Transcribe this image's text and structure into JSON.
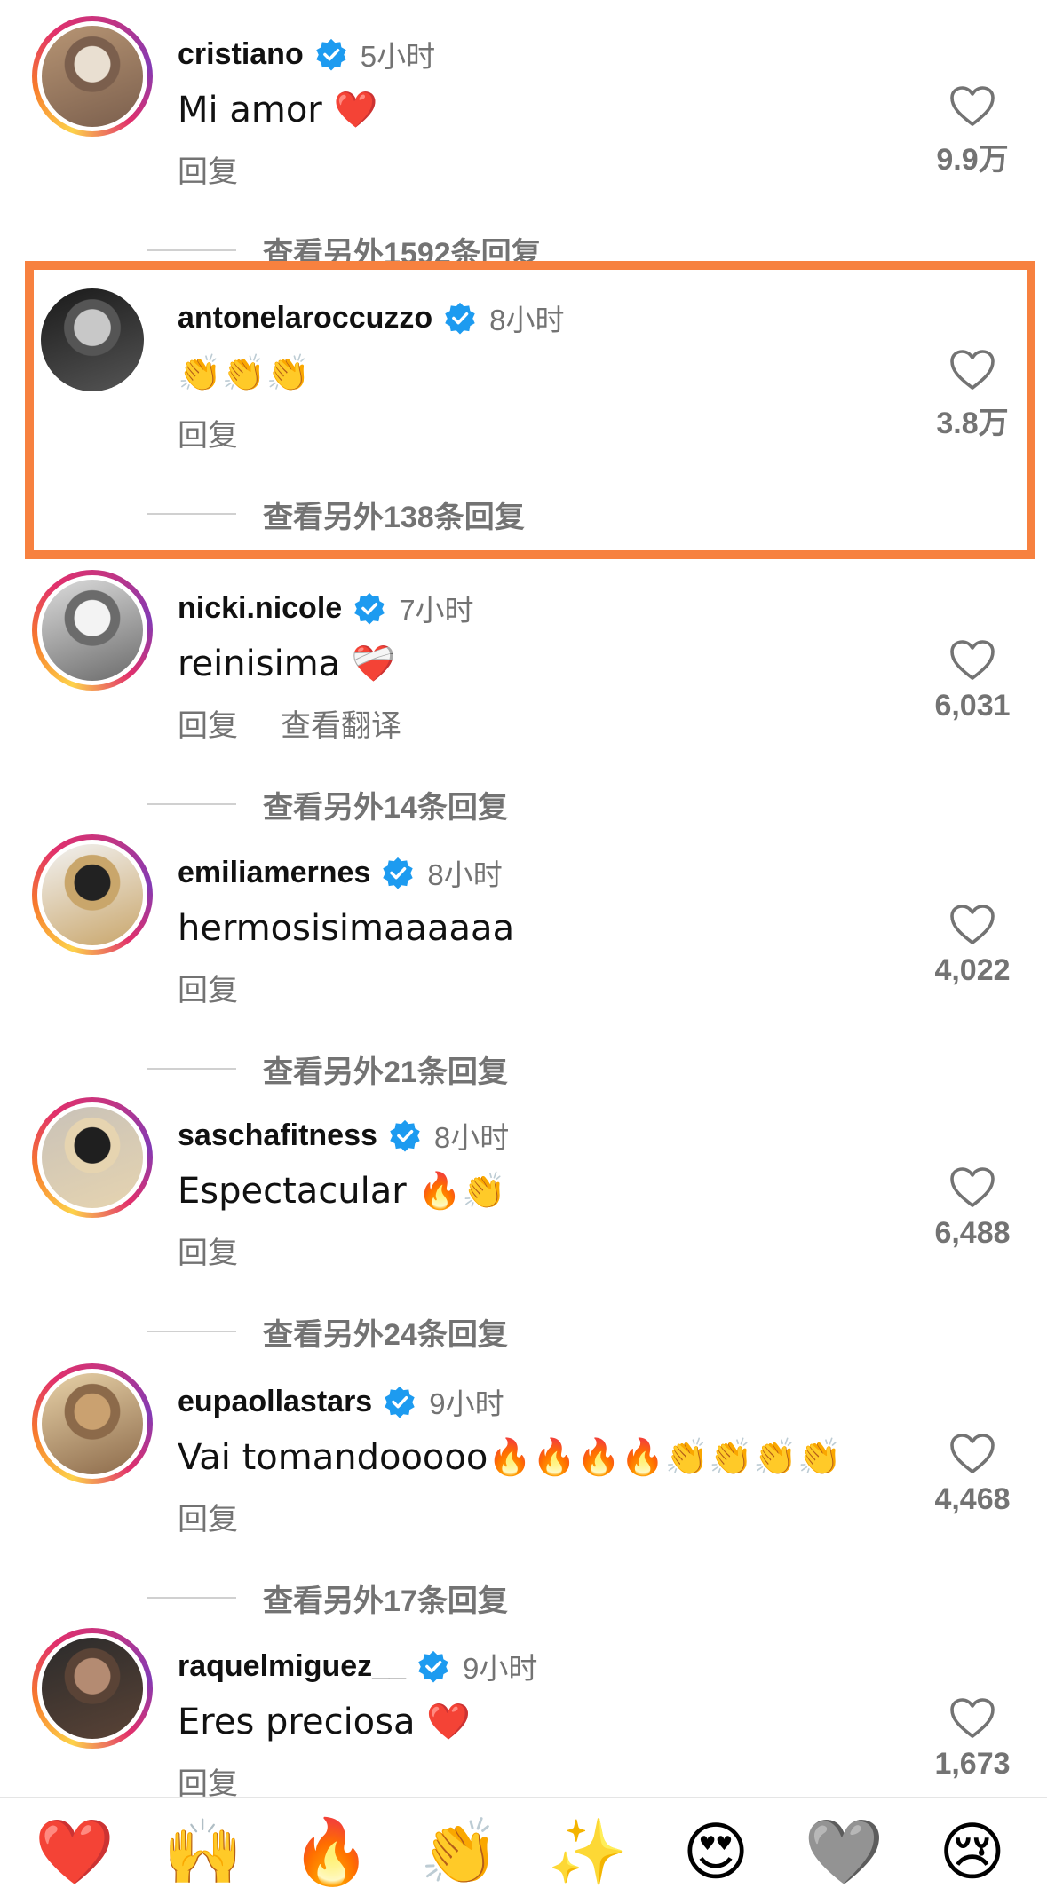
{
  "comments": [
    {
      "username": "cristiano",
      "time": "5小时",
      "text": "Mi amor ❤️",
      "reply": "回复",
      "likes": "9.9万",
      "view_replies": "查看另外1592条回复",
      "ring": true,
      "avatar_colors": [
        "#b79574",
        "#e9dfd1",
        "#7b5f4d"
      ]
    },
    {
      "username": "antonelaroccuzzo",
      "time": "8小时",
      "text": "👏👏👏",
      "reply": "回复",
      "likes": "3.8万",
      "view_replies": "查看另外138条回复",
      "ring": false,
      "avatar_colors": [
        "#1a1a1a",
        "#c8c8c8",
        "#555555"
      ]
    },
    {
      "username": "nicki.nicole",
      "time": "7小时",
      "text": "reinisima ❤️‍🩹",
      "reply": "回复",
      "translate": "查看翻译",
      "likes": "6,031",
      "view_replies": "查看另外14条回复",
      "ring": true,
      "avatar_colors": [
        "#dcdcdc",
        "#f3f3f3",
        "#6b6b6b"
      ]
    },
    {
      "username": "emiliamernes",
      "time": "8小时",
      "text": "hermosisimaaaaaa",
      "reply": "回复",
      "likes": "4,022",
      "view_replies": "查看另外21条回复",
      "ring": true,
      "avatar_colors": [
        "#f2f2f2",
        "#222222",
        "#c9a66b"
      ]
    },
    {
      "username": "saschafitness",
      "time": "8小时",
      "text": "Espectacular 🔥👏",
      "reply": "回复",
      "likes": "6,488",
      "view_replies": "查看另外24条回复",
      "ring": true,
      "avatar_colors": [
        "#c9c2b8",
        "#1f1f1f",
        "#e6d4b0"
      ]
    },
    {
      "username": "eupaollastars",
      "time": "9小时",
      "text": "Vai tomandooooo🔥🔥🔥🔥👏👏👏👏",
      "reply": "回复",
      "likes": "4,468",
      "view_replies": "查看另外17条回复",
      "ring": true,
      "avatar_colors": [
        "#e8d2a8",
        "#caa170",
        "#8c6a4a"
      ]
    },
    {
      "username": "raquelmiguez__",
      "time": "9小时",
      "text": "Eres preciosa ❤️",
      "reply": "回复",
      "likes": "1,673",
      "ring": true,
      "avatar_colors": [
        "#2b2b2b",
        "#b48b72",
        "#5a4336"
      ]
    }
  ],
  "emoji_bar": [
    "❤️",
    "🙌",
    "🔥",
    "👏",
    "✨",
    "😍",
    "🩶",
    "😢"
  ],
  "colors": {
    "verified": "#1d9bf0",
    "highlight": "#f7813f",
    "secondary_text": "#737373"
  },
  "icons": {
    "verified": "verified-badge-icon",
    "like": "heart-outline-icon"
  }
}
